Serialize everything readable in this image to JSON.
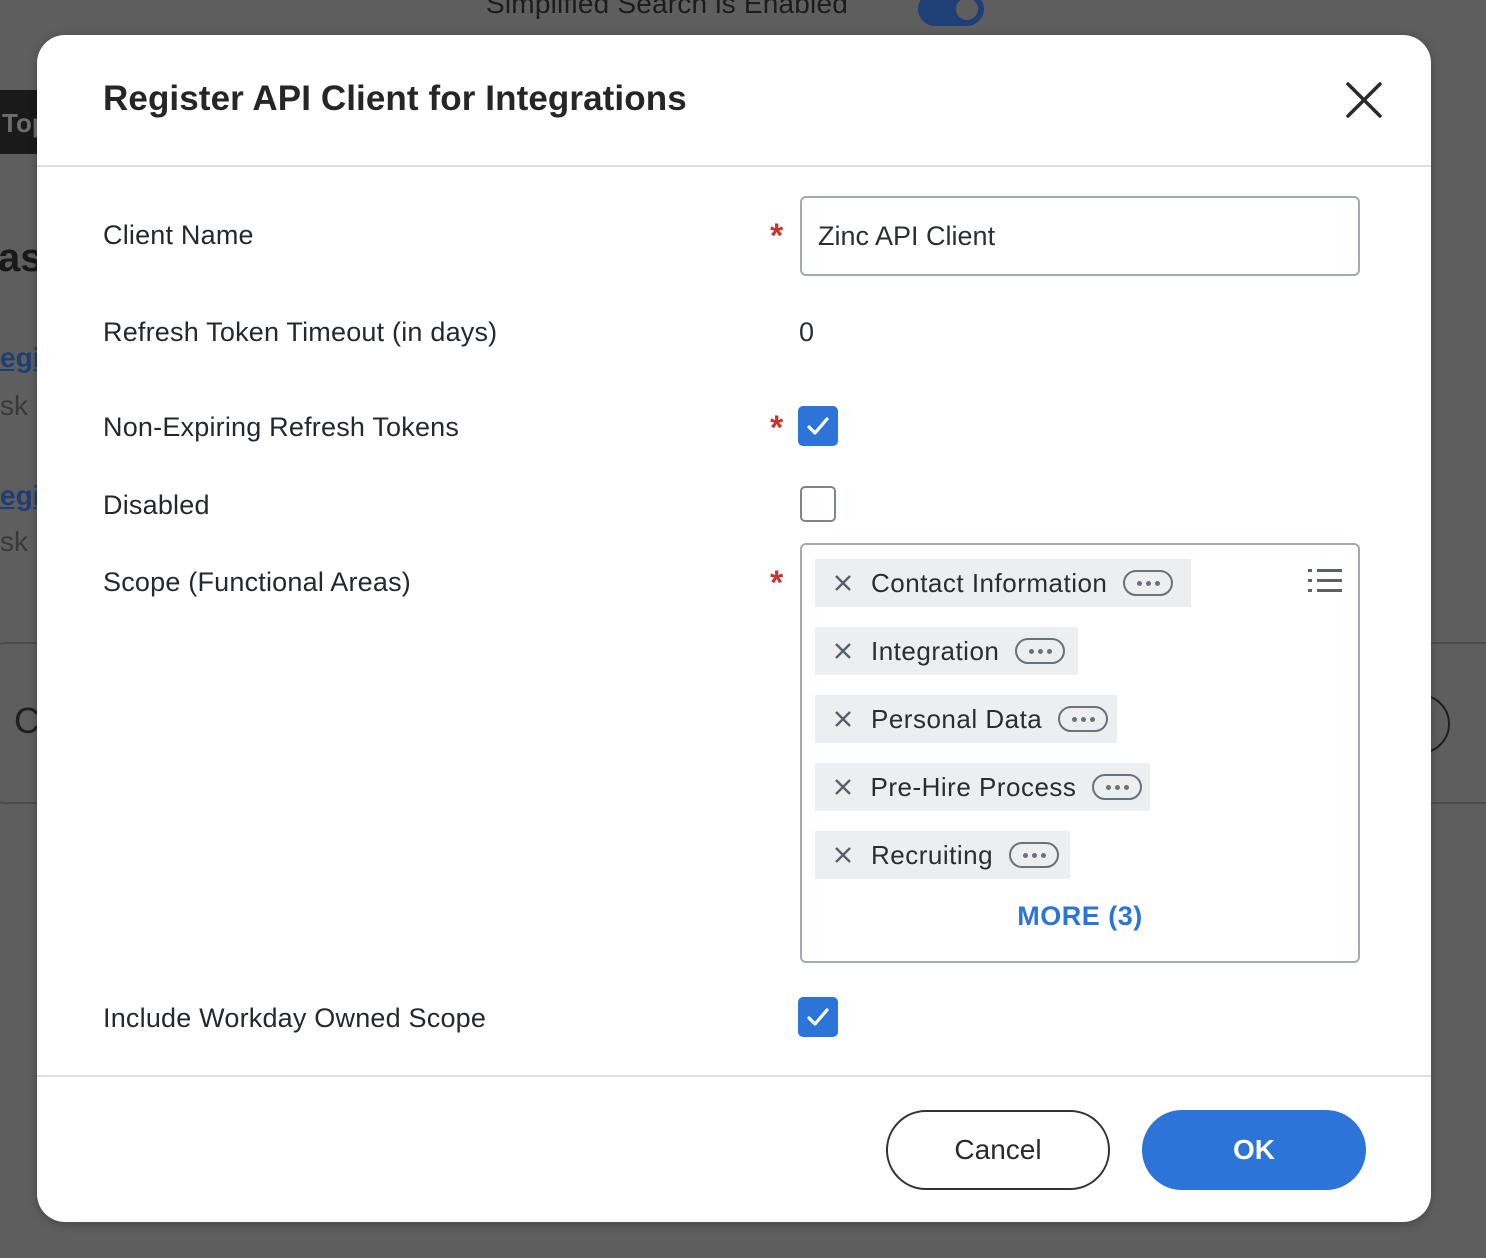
{
  "background": {
    "search_status": "Simplified Search is Enabled",
    "frag_top": "Top",
    "frag_heading": "ash",
    "frag_link_1": "egis",
    "frag_sub_1": "sk",
    "frag_link_2": "egis",
    "frag_sub_2": "sk",
    "frag_card_letter": "C"
  },
  "dialog": {
    "title": "Register API Client for Integrations",
    "close_icon": "close-icon",
    "fields": {
      "client_name": {
        "label": "Client Name",
        "value": "Zinc API Client",
        "required": true
      },
      "refresh_timeout": {
        "label": "Refresh Token Timeout (in days)",
        "value": "0"
      },
      "non_expiring": {
        "label": "Non-Expiring Refresh Tokens",
        "checked": true,
        "required": true
      },
      "disabled": {
        "label": "Disabled",
        "checked": false
      },
      "scope": {
        "label": "Scope (Functional Areas)",
        "required": true,
        "items": [
          "Contact Information",
          "Integration",
          "Personal Data",
          "Pre-Hire Process",
          "Recruiting"
        ],
        "more_label": "MORE (3)"
      },
      "workday_scope": {
        "label": "Include Workday Owned Scope",
        "checked": true
      }
    },
    "required_marker": "*",
    "buttons": {
      "cancel": "Cancel",
      "ok": "OK"
    }
  },
  "colors": {
    "accent": "#2c74d8",
    "required": "#c4362f",
    "overlay": "#5e5e5e"
  }
}
